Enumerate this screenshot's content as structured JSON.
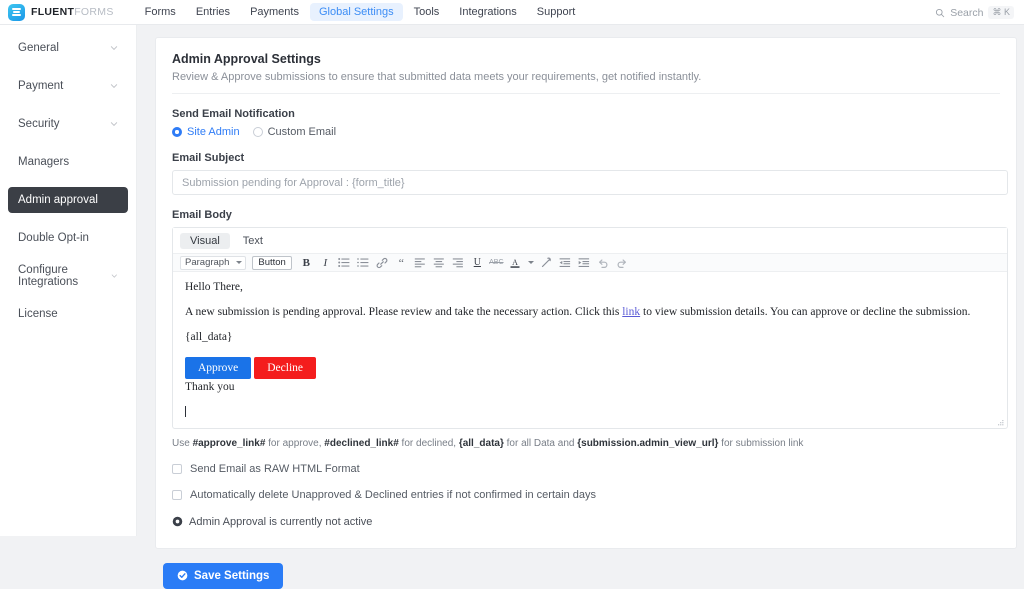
{
  "header": {
    "brand_bold": "FLUENT",
    "brand_light": "FORMS",
    "logo_icon": "fluent-forms-logo",
    "nav": [
      {
        "label": "Forms",
        "active": false
      },
      {
        "label": "Entries",
        "active": false
      },
      {
        "label": "Payments",
        "active": false
      },
      {
        "label": "Global Settings",
        "active": true
      },
      {
        "label": "Tools",
        "active": false
      },
      {
        "label": "Integrations",
        "active": false
      },
      {
        "label": "Support",
        "active": false
      }
    ],
    "search_label": "Search",
    "search_shortcut": "⌘ K",
    "search_icon": "search-icon"
  },
  "sidebar": {
    "items": [
      {
        "label": "General",
        "chevron": true,
        "active": false
      },
      {
        "label": "Payment",
        "chevron": true,
        "active": false
      },
      {
        "label": "Security",
        "chevron": true,
        "active": false
      },
      {
        "label": "Managers",
        "chevron": false,
        "active": false
      },
      {
        "label": "Admin approval",
        "chevron": false,
        "active": true
      },
      {
        "label": "Double Opt-in",
        "chevron": false,
        "active": false
      },
      {
        "label": "Configure Integrations",
        "chevron": true,
        "active": false
      },
      {
        "label": "License",
        "chevron": false,
        "active": false
      }
    ]
  },
  "main": {
    "title": "Admin Approval Settings",
    "subtitle": "Review & Approve submissions to ensure that submitted data meets your requirements, get notified instantly.",
    "notification": {
      "label": "Send Email Notification",
      "options": [
        {
          "label": "Site Admin",
          "selected": true
        },
        {
          "label": "Custom Email",
          "selected": false
        }
      ]
    },
    "email_subject": {
      "label": "Email Subject",
      "value": "Submission pending for Approval : {form_title}",
      "placeholder": "Submission pending for Approval : {form_title}"
    },
    "email_body": {
      "label": "Email Body",
      "tabs": [
        {
          "label": "Visual",
          "active": true
        },
        {
          "label": "Text",
          "active": false
        }
      ],
      "toolbar": {
        "format_select": "Paragraph",
        "button_label": "Button",
        "icons": [
          "bold-icon",
          "italic-icon",
          "bulleted-list-icon",
          "numbered-list-icon",
          "link-icon",
          "blockquote-icon",
          "align-left-icon",
          "align-center-icon",
          "align-right-icon",
          "underline-icon",
          "strikethrough-icon",
          "text-color-icon",
          "chevron-down-icon",
          "clear-formatting-icon",
          "outdent-icon",
          "indent-icon",
          "undo-icon",
          "redo-icon"
        ]
      },
      "content": {
        "greeting": "Hello There,",
        "paragraph_pre_link": "A new submission is pending approval. Please review and take the necessary action. Click this ",
        "link_text": "link",
        "paragraph_post_link": " to view submission details. You can approve or decline the submission.",
        "shortcode": "{all_data}",
        "approve_button": "Approve",
        "decline_button": "Decline",
        "closing": "Thank you"
      }
    },
    "hint": {
      "part1": "Use ",
      "code1": "#approve_link#",
      "part2": " for approve, ",
      "code2": "#declined_link#",
      "part3": " for declined, ",
      "code3": "{all_data}",
      "part4": " for all Data and ",
      "code4": "{submission.admin_view_url}",
      "part5": " for submission link"
    },
    "checkboxes": [
      {
        "label": "Send Email as RAW HTML Format",
        "checked": false
      },
      {
        "label": "Automatically delete Unapproved & Declined entries if not confirmed in certain days",
        "checked": false
      }
    ],
    "status": {
      "icon": "status-circle-icon",
      "text": "Admin Approval is currently not active"
    }
  },
  "footer": {
    "save_label": "Save Settings",
    "save_icon": "check-circle-icon"
  },
  "colors": {
    "accent_blue": "#2f7cf6",
    "nav_active_bg": "#e8f1fe",
    "sidebar_active_bg": "#3b3f46",
    "approve_blue": "#1a73e8",
    "decline_red": "#f41d1d",
    "link_purple": "#5b5bd6"
  }
}
